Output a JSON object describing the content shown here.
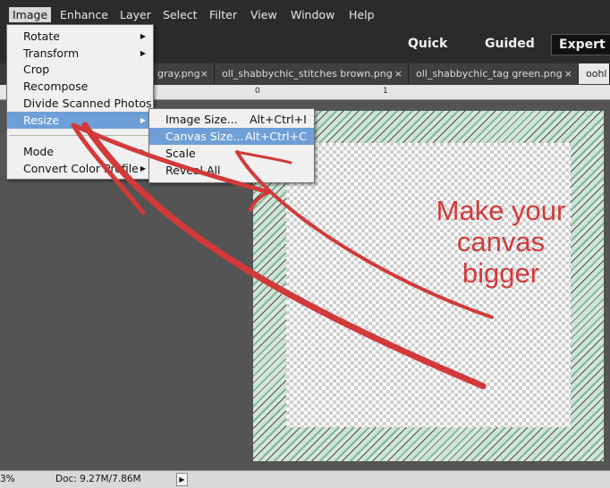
{
  "menubar": {
    "items": [
      "Image",
      "Enhance",
      "Layer",
      "Select",
      "Filter",
      "View",
      "Window",
      "Help"
    ]
  },
  "modes": [
    "Quick",
    "Guided",
    "Expert"
  ],
  "tabs": [
    {
      "label": "gray.png"
    },
    {
      "label": "oll_shabbychic_stitches brown.png"
    },
    {
      "label": "oll_shabbychic_tag green.png"
    },
    {
      "label": "oohl"
    }
  ],
  "tab_close": "×",
  "ruler": {
    "marks": [
      "0",
      "1"
    ]
  },
  "image_menu": {
    "items": [
      {
        "label": "Rotate",
        "submenu": "▶"
      },
      {
        "label": "Transform",
        "submenu": "▶"
      },
      {
        "label": "Crop"
      },
      {
        "label": "Recompose"
      },
      {
        "label": "Divide Scanned Photos"
      },
      {
        "label": "Resize",
        "submenu": "▶"
      },
      {
        "label": "Mode",
        "submenu": "▶"
      },
      {
        "label": "Convert Color Profile",
        "submenu": "▶"
      }
    ]
  },
  "resize_menu": {
    "items": [
      {
        "label": "Image Size...",
        "shortcut": "Alt+Ctrl+I"
      },
      {
        "label": "Canvas Size...",
        "shortcut": "Alt+Ctrl+C"
      },
      {
        "label": "Scale"
      },
      {
        "label": "Reveal All"
      }
    ]
  },
  "annotation": {
    "lines": [
      "Make  your",
      "canvas",
      "bigger"
    ],
    "color": "#d23a3a"
  },
  "status": {
    "zoom": "3%",
    "doc": "Doc: 9.27M/7.86M",
    "arrow": "▶"
  },
  "colors": {
    "highlight": "#6e9fd7",
    "menubar": "#2b2b2b",
    "annotation": "#d23a3a"
  }
}
